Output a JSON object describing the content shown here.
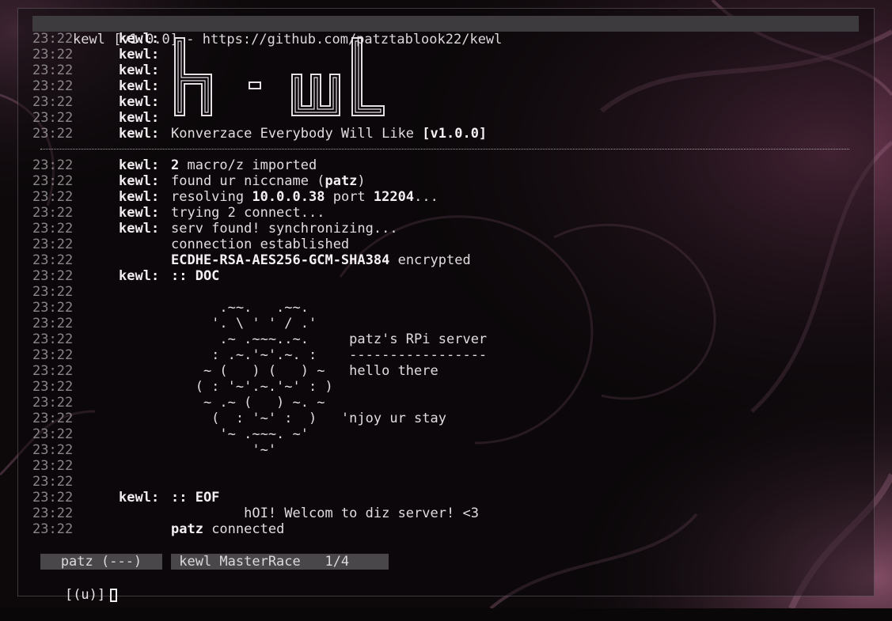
{
  "window": {
    "title": "kewl [v1.0.0] - https://github.com/patztablook22/kewl"
  },
  "colors": {
    "accent": "#b4407a",
    "status_bg": "#4a474a",
    "title_bg": "#3e3b3e"
  },
  "header_lines": [
    {
      "time": "23:22",
      "nick": "kewl:"
    },
    {
      "time": "23:22",
      "nick": "kewl:"
    },
    {
      "time": "23:22",
      "nick": "kewl:"
    },
    {
      "time": "23:22",
      "nick": "kewl:"
    },
    {
      "time": "23:22",
      "nick": "kewl:"
    },
    {
      "time": "23:22",
      "nick": "kewl:"
    }
  ],
  "logo_text": "kewl",
  "tagline": {
    "time": "23:22",
    "nick": "kewl:",
    "text": "Konverzace Everybody Will Like ",
    "version": "[v1.0.0]"
  },
  "log": [
    {
      "time": "23:22",
      "nick": "kewl:",
      "b1": "2",
      "t1": " macro/z imported"
    },
    {
      "time": "23:22",
      "nick": "kewl:",
      "t0": "found ur niccname (",
      "b1": "patz",
      "t1": ")"
    },
    {
      "time": "23:22",
      "nick": "kewl:",
      "t0": "resolving ",
      "b1": "10.0.0.38",
      "t1": " port ",
      "b2": "12204",
      "t2": "..."
    },
    {
      "time": "23:22",
      "nick": "kewl:",
      "t0": "trying 2 connect..."
    },
    {
      "time": "23:22",
      "nick": "kewl:",
      "t0": "serv found! synchronizing..."
    },
    {
      "time": "23:22",
      "nick": "",
      "t0": "connection established"
    },
    {
      "time": "23:22",
      "nick": "",
      "b1": "ECDHE-RSA-AES256-GCM-SHA384",
      "t1": " encrypted"
    },
    {
      "time": "23:22",
      "nick": "kewl:",
      "b1": ":: DOC"
    }
  ],
  "doc_times": [
    "23:22",
    "23:22",
    "23:22",
    "23:22",
    "23:22",
    "23:22",
    "23:22",
    "23:22",
    "23:22",
    "23:22",
    "23:22",
    "23:22",
    "23:22"
  ],
  "doc_art": [
    "",
    "      .~~.   .~~.",
    "     '. \\ ' ' / .'",
    "      .~ .~~~..~.     patz's RPi server",
    "     : .~.'~'.~. :    -----------------",
    "    ~ (   ) (   ) ~   hello there",
    "   ( : '~'.~.'~' : )",
    "    ~ .~ (   ) ~. ~",
    "     (  : '~' :  )   'njoy ur stay",
    "      '~ .~~~. ~'",
    "          '~'",
    "",
    ""
  ],
  "tail": [
    {
      "time": "23:22",
      "nick": "kewl:",
      "b1": ":: EOF"
    },
    {
      "time": "23:22",
      "nick": "",
      "t0": "         hOI! Welcom to diz server! <3"
    },
    {
      "time": "23:22",
      "nick": "",
      "b1": "patz",
      "t1": " connected"
    }
  ],
  "status": {
    "user": " patz (---) ",
    "channel": " kewl MasterRace   1/4 "
  },
  "prompt": "[(u)]"
}
